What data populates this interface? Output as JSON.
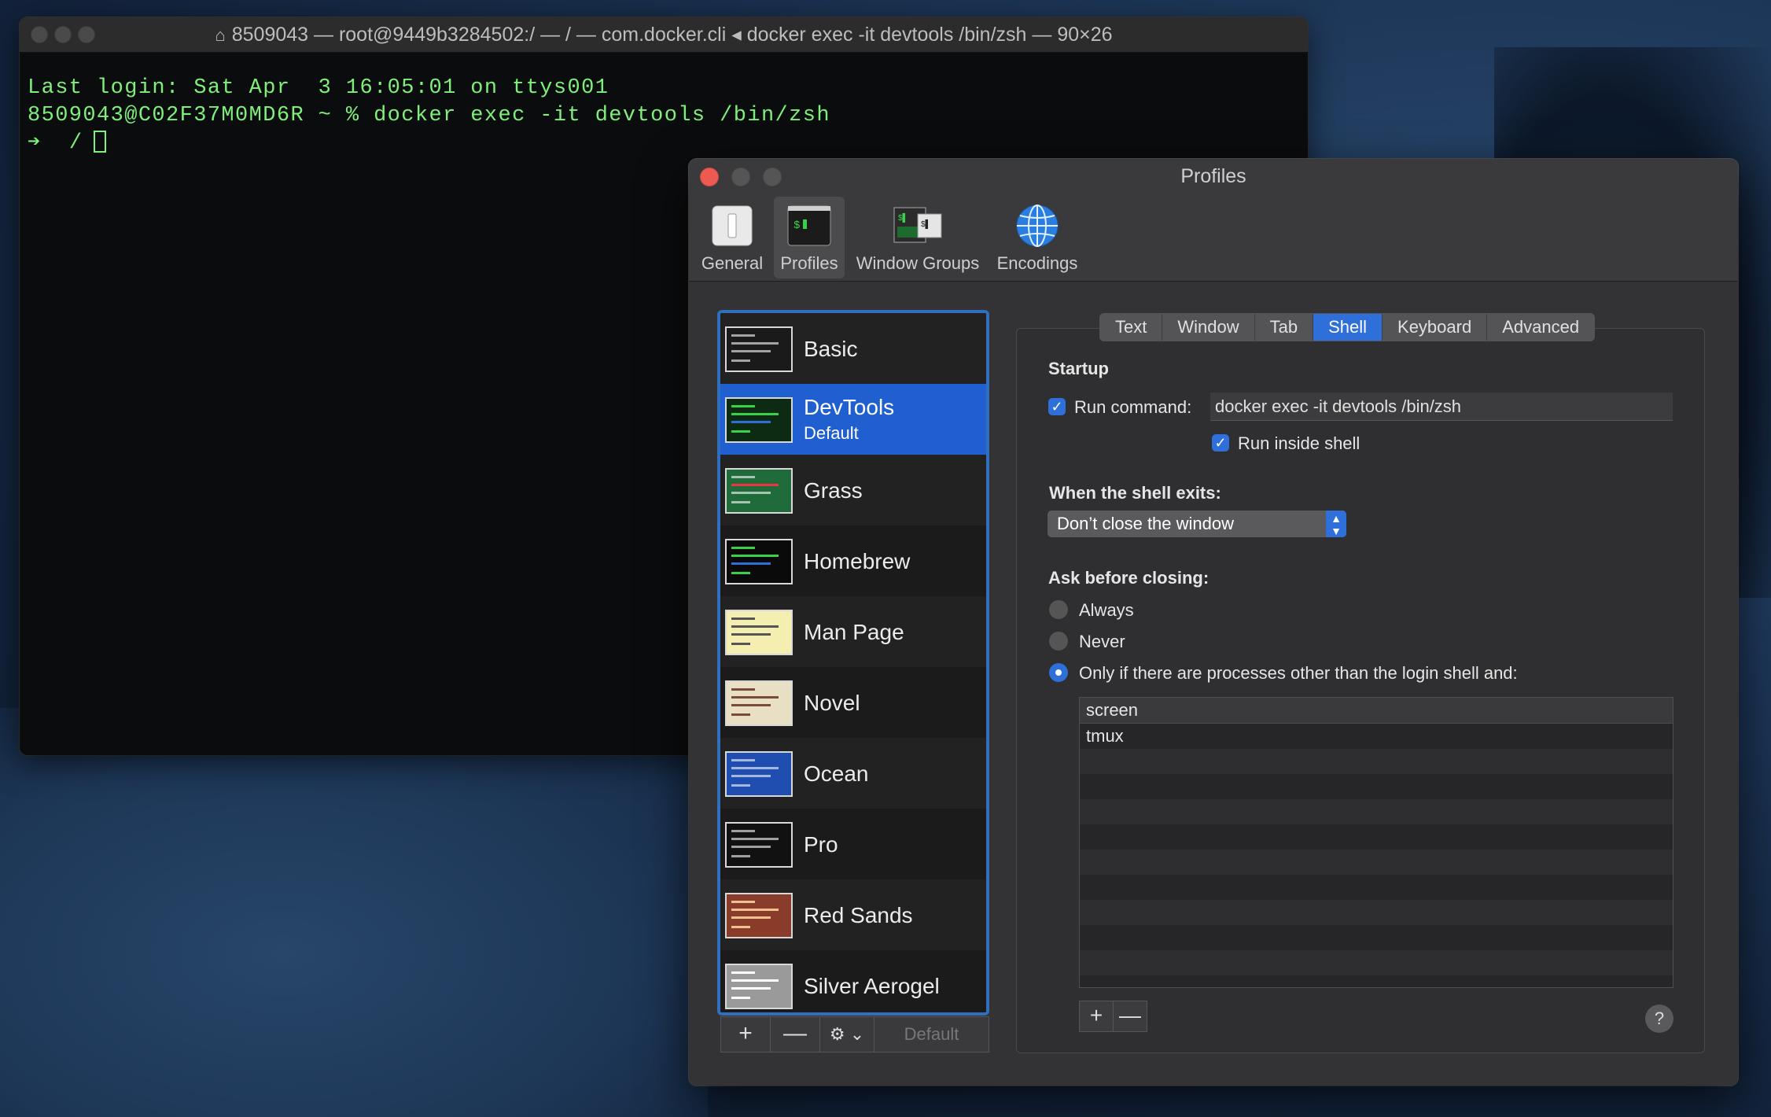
{
  "terminal": {
    "title": "8509043 — root@9449b3284502:/ — / — com.docker.cli ◂ docker exec -it devtools /bin/zsh — 90×26",
    "lines": [
      "Last login: Sat Apr  3 16:05:01 on ttys001",
      "8509043@C02F37M0MD6R ~ % docker exec -it devtools /bin/zsh"
    ],
    "prompt": "➔  /"
  },
  "prefs": {
    "title": "Profiles",
    "toolbar": [
      {
        "label": "General",
        "icon": "switch-icon"
      },
      {
        "label": "Profiles",
        "icon": "terminal-icon"
      },
      {
        "label": "Window Groups",
        "icon": "window-groups-icon"
      },
      {
        "label": "Encodings",
        "icon": "globe-icon"
      }
    ],
    "profiles": [
      {
        "name": "Basic",
        "thumb": "#1a1a1a"
      },
      {
        "name": "DevTools",
        "sub": "Default",
        "thumb": "#0d2a12"
      },
      {
        "name": "Grass",
        "thumb": "#1f6b3a"
      },
      {
        "name": "Homebrew",
        "thumb": "#0a0a0a"
      },
      {
        "name": "Man Page",
        "thumb": "#f4eeb0"
      },
      {
        "name": "Novel",
        "thumb": "#e8dfc4"
      },
      {
        "name": "Ocean",
        "thumb": "#1f4db0"
      },
      {
        "name": "Pro",
        "thumb": "#111111"
      },
      {
        "name": "Red Sands",
        "thumb": "#8a3c2a"
      },
      {
        "name": "Silver Aerogel",
        "thumb": "#9a9a9a"
      }
    ],
    "list_buttons": {
      "add": "+",
      "remove": "—",
      "gear": "⚙ ⌄",
      "default": "Default"
    },
    "tabs": [
      "Text",
      "Window",
      "Tab",
      "Shell",
      "Keyboard",
      "Advanced"
    ],
    "active_tab": "Shell",
    "shell": {
      "startup_heading": "Startup",
      "run_command_label": "Run command:",
      "run_command_value": "docker exec -it devtools /bin/zsh",
      "run_inside_shell_label": "Run inside shell",
      "exit_heading": "When the shell exits:",
      "exit_option": "Don’t close the window",
      "ask_heading": "Ask before closing:",
      "radio_always": "Always",
      "radio_never": "Never",
      "radio_only_if": "Only if there are processes other than the login shell and:",
      "processes": [
        "screen",
        "tmux"
      ],
      "add_btn": "+",
      "remove_btn": "—",
      "help": "?"
    }
  }
}
